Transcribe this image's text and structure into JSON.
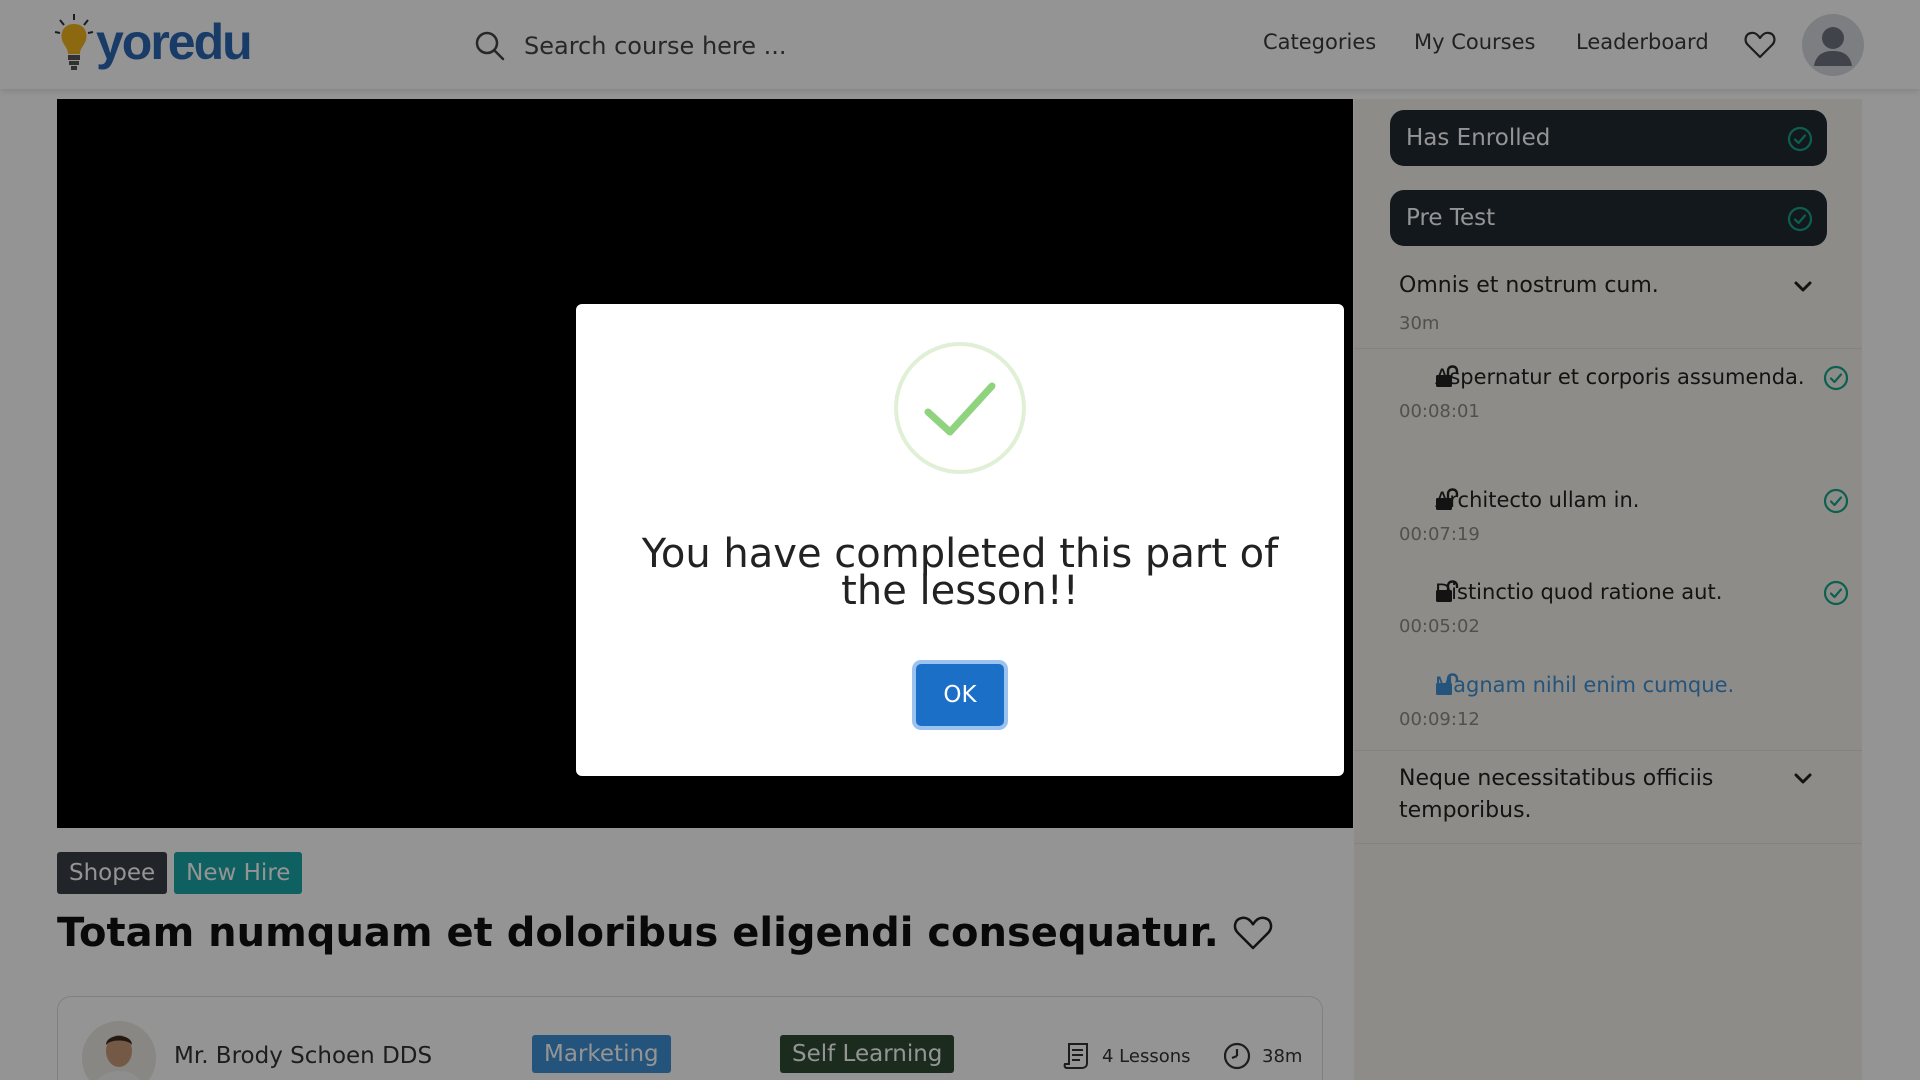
{
  "header": {
    "logo_text": "yoredu",
    "search_placeholder": "Search course here ...",
    "nav": {
      "categories": "Categories",
      "my_courses": "My Courses",
      "leaderboard": "Leaderboard"
    }
  },
  "course": {
    "tags": [
      "Shopee",
      "New Hire"
    ],
    "title": "Totam numquam et doloribus eligendi consequatur.",
    "instructor": "Mr. Brody Schoen DDS",
    "category": "Marketing",
    "type": "Self Learning",
    "lessons": "4 Lessons",
    "duration": "38m"
  },
  "sidebar": {
    "has_enrolled": "Has Enrolled",
    "pre_test": "Pre Test",
    "section1": {
      "title": "Omnis et nostrum cum.",
      "duration": "30m"
    },
    "lessons": [
      {
        "title": "Aspernatur et corporis assumenda.",
        "time": "00:08:01"
      },
      {
        "title": "Architecto ullam in.",
        "time": "00:07:19"
      },
      {
        "title": "Distinctio quod ratione aut.",
        "time": "00:05:02"
      },
      {
        "title": "Magnam nihil enim cumque.",
        "time": "00:09:12"
      }
    ],
    "section2": {
      "title": "Neque necessitatibus officiis temporibus."
    }
  },
  "modal": {
    "message": "You have completed this part of the lesson!!",
    "ok_label": "OK"
  },
  "colors": {
    "brand_blue": "#2a67b1",
    "pill_dark": "#222a33",
    "check_teal": "#17a589",
    "active_lesson": "#3f8fd4",
    "success_green": "#8fd37e",
    "ok_button": "#1c6fc7"
  },
  "icons": {
    "search": "search-icon",
    "heart": "heart-icon",
    "check": "check-circle-icon",
    "lock": "unlock-icon",
    "chevron": "chevron-down-icon",
    "lessons": "scroll-icon",
    "clock": "clock-icon",
    "success": "checkmark-icon"
  }
}
